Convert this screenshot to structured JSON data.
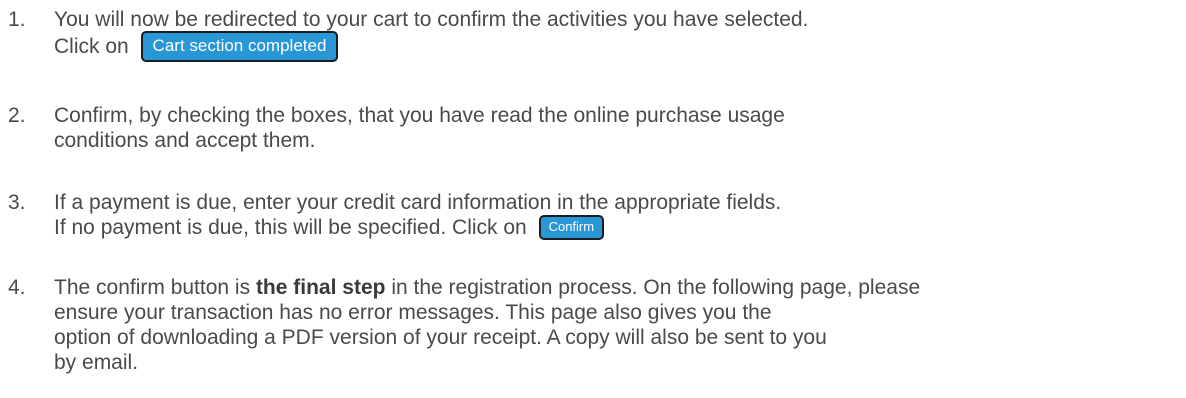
{
  "steps": [
    {
      "number": "1.",
      "line1": "You will now be redirected to your cart to confirm the activities you have selected.",
      "line2_prefix": "Click on",
      "button_label": "Cart section completed"
    },
    {
      "number": "2.",
      "line1": "Confirm, by checking the boxes, that you have read the online purchase usage",
      "line2": "conditions and accept them."
    },
    {
      "number": "3.",
      "line1": "If a payment is due, enter your credit card information in the appropriate fields.",
      "line2_prefix": "If no payment is due, this will be specified. Click on",
      "button_label": "Confirm"
    },
    {
      "number": "4.",
      "line1_prefix": "The confirm button is",
      "line1_bold": "the final step",
      "line1_suffix": "in the registration process. On the following page, please",
      "line2": "ensure your transaction has no error messages. This page also gives you the",
      "line3": "option of downloading a PDF version of your receipt. A copy will also be sent to you",
      "line4": "by email."
    }
  ],
  "colors": {
    "text": "#4a4a4a",
    "button_bg": "#2996d6",
    "button_text": "#ffffff",
    "button_border": "#1d1d1d"
  }
}
